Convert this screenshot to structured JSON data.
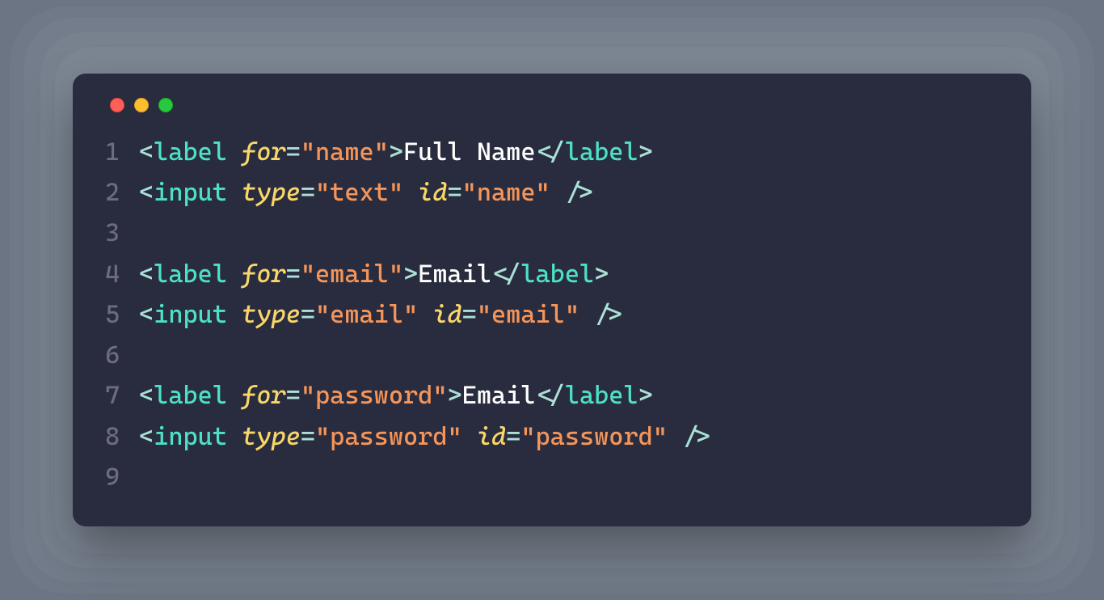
{
  "window_controls": {
    "red": "close",
    "yellow": "minimize",
    "green": "maximize"
  },
  "code": {
    "lines": [
      {
        "num": "1",
        "segments": [
          {
            "t": "bracket",
            "v": "<"
          },
          {
            "t": "tag",
            "v": "label"
          },
          {
            "t": "text",
            "v": " "
          },
          {
            "t": "attr",
            "v": "for"
          },
          {
            "t": "eq",
            "v": "="
          },
          {
            "t": "string",
            "v": "\"name\""
          },
          {
            "t": "bracket",
            "v": ">"
          },
          {
            "t": "text",
            "v": "Full Name"
          },
          {
            "t": "bracket",
            "v": "</"
          },
          {
            "t": "tag",
            "v": "label"
          },
          {
            "t": "bracket",
            "v": ">"
          }
        ]
      },
      {
        "num": "2",
        "segments": [
          {
            "t": "bracket",
            "v": "<"
          },
          {
            "t": "tag",
            "v": "input"
          },
          {
            "t": "text",
            "v": " "
          },
          {
            "t": "attr",
            "v": "type"
          },
          {
            "t": "eq",
            "v": "="
          },
          {
            "t": "string",
            "v": "\"text\""
          },
          {
            "t": "text",
            "v": " "
          },
          {
            "t": "attr",
            "v": "id"
          },
          {
            "t": "eq",
            "v": "="
          },
          {
            "t": "string",
            "v": "\"name\""
          },
          {
            "t": "text",
            "v": " "
          },
          {
            "t": "bracket",
            "v": "/>"
          }
        ]
      },
      {
        "num": "3",
        "segments": []
      },
      {
        "num": "4",
        "segments": [
          {
            "t": "bracket",
            "v": "<"
          },
          {
            "t": "tag",
            "v": "label"
          },
          {
            "t": "text",
            "v": " "
          },
          {
            "t": "attr",
            "v": "for"
          },
          {
            "t": "eq",
            "v": "="
          },
          {
            "t": "string",
            "v": "\"email\""
          },
          {
            "t": "bracket",
            "v": ">"
          },
          {
            "t": "text",
            "v": "Email"
          },
          {
            "t": "bracket",
            "v": "</"
          },
          {
            "t": "tag",
            "v": "label"
          },
          {
            "t": "bracket",
            "v": ">"
          }
        ]
      },
      {
        "num": "5",
        "segments": [
          {
            "t": "bracket",
            "v": "<"
          },
          {
            "t": "tag",
            "v": "input"
          },
          {
            "t": "text",
            "v": " "
          },
          {
            "t": "attr",
            "v": "type"
          },
          {
            "t": "eq",
            "v": "="
          },
          {
            "t": "string",
            "v": "\"email\""
          },
          {
            "t": "text",
            "v": " "
          },
          {
            "t": "attr",
            "v": "id"
          },
          {
            "t": "eq",
            "v": "="
          },
          {
            "t": "string",
            "v": "\"email\""
          },
          {
            "t": "text",
            "v": " "
          },
          {
            "t": "bracket",
            "v": "/>"
          }
        ]
      },
      {
        "num": "6",
        "segments": []
      },
      {
        "num": "7",
        "segments": [
          {
            "t": "bracket",
            "v": "<"
          },
          {
            "t": "tag",
            "v": "label"
          },
          {
            "t": "text",
            "v": " "
          },
          {
            "t": "attr",
            "v": "for"
          },
          {
            "t": "eq",
            "v": "="
          },
          {
            "t": "string",
            "v": "\"password\""
          },
          {
            "t": "bracket",
            "v": ">"
          },
          {
            "t": "text",
            "v": "Email"
          },
          {
            "t": "bracket",
            "v": "</"
          },
          {
            "t": "tag",
            "v": "label"
          },
          {
            "t": "bracket",
            "v": ">"
          }
        ]
      },
      {
        "num": "8",
        "segments": [
          {
            "t": "bracket",
            "v": "<"
          },
          {
            "t": "tag",
            "v": "input"
          },
          {
            "t": "text",
            "v": " "
          },
          {
            "t": "attr",
            "v": "type"
          },
          {
            "t": "eq",
            "v": "="
          },
          {
            "t": "string",
            "v": "\"password\""
          },
          {
            "t": "text",
            "v": " "
          },
          {
            "t": "attr",
            "v": "id"
          },
          {
            "t": "eq",
            "v": "="
          },
          {
            "t": "string",
            "v": "\"password\""
          },
          {
            "t": "text",
            "v": " "
          },
          {
            "t": "bracket",
            "v": "/>"
          }
        ]
      },
      {
        "num": "9",
        "segments": []
      }
    ]
  }
}
